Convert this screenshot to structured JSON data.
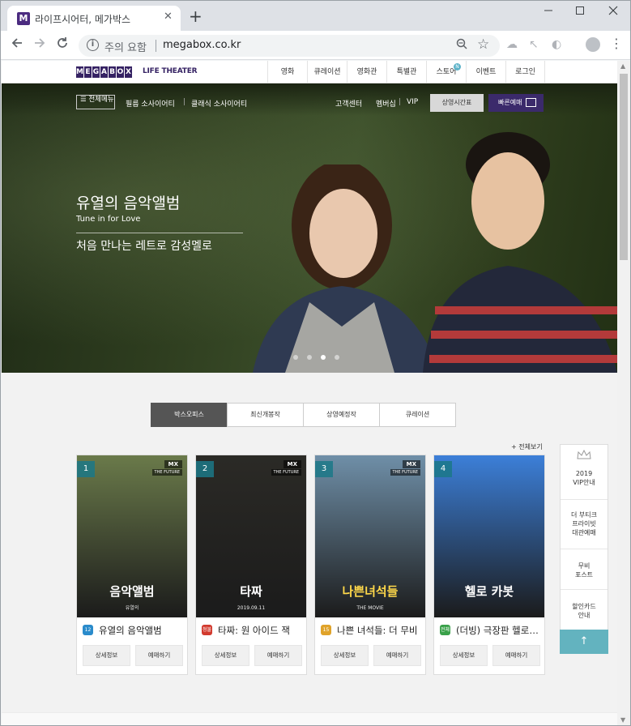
{
  "browser": {
    "tab_title": "라이프시어터, 메가박스",
    "tab_favicon": "M",
    "tab_close": "✕",
    "new_tab": "+",
    "security_warning": "주의 요함",
    "url": "megabox.co.kr"
  },
  "header": {
    "logo_letters": [
      "M",
      "E",
      "G",
      "A",
      "B",
      "O",
      "X"
    ],
    "logo_sub": "LIFE THEATER",
    "nav": [
      {
        "label": "영화"
      },
      {
        "label": "큐레이션"
      },
      {
        "label": "영화관"
      },
      {
        "label": "특별관"
      },
      {
        "label": "스토어",
        "badge": "N"
      },
      {
        "label": "이벤트"
      },
      {
        "label": "로그인"
      }
    ]
  },
  "hero": {
    "all_menu": "☰ 전체메뉴",
    "link_film_society": "필름 소사이어티",
    "link_classic_society": "클래식 소사이어티",
    "link_customer": "고객센터",
    "link_membership": "멤버십",
    "link_vip": "VIP",
    "schedule_button": "상영시간표",
    "fast_booking_button": "빠른예매",
    "title": "유열의 음악앨범",
    "subtitle": "Tune in for Love",
    "copy": "처음 만나는 레트로 감성멜로",
    "slide_count": 4,
    "active_slide": 2
  },
  "tabs": [
    "박스오피스",
    "최신개봉작",
    "상영예정작",
    "큐레이션"
  ],
  "active_tab": 0,
  "see_all": "+ 전체보기",
  "movies": [
    {
      "rank": "1",
      "title": "유열의 음악앨범",
      "age": "12",
      "age_color": "#2a8bcb",
      "poster_title": "음악앨범",
      "poster_sub": "유열의",
      "poster_color": "#6a7a4a",
      "has_mx": true
    },
    {
      "rank": "2",
      "title": "타짜: 원 아이드 잭",
      "age": "청불",
      "age_color": "#d23a2e",
      "poster_title": "타짜",
      "poster_sub": "2019.09.11",
      "poster_color": "#2b2a26",
      "has_mx": true
    },
    {
      "rank": "3",
      "title": "나쁜 녀석들: 더 무비",
      "age": "15",
      "age_color": "#e0a32a",
      "poster_title": "나쁜녀석들",
      "poster_sub": "THE MOVIE",
      "poster_color": "#6f8fa8",
      "has_mx": true
    },
    {
      "rank": "4",
      "title": "(더빙) 극장판 헬로카봇",
      "age": "전체",
      "age_color": "#3aa14a",
      "poster_title": "헬로 카봇",
      "poster_sub": "",
      "poster_color": "#3c7fd8",
      "has_mx": false
    }
  ],
  "card_buttons": {
    "detail": "상세정보",
    "book": "예매하기"
  },
  "mx_label": "MX",
  "mx_sub": "THE FUTURE",
  "side_banner": {
    "vip": [
      "2019",
      "VIP안내"
    ],
    "private": [
      "더 부티크",
      "프라이빗",
      "대관예매"
    ],
    "post": [
      "무비",
      "포스트"
    ],
    "card": [
      "할인카드",
      "안내"
    ],
    "top": "↑"
  },
  "colors": {
    "brand": "#352263",
    "accent": "#63b3bf",
    "tab_active": "#555555"
  }
}
